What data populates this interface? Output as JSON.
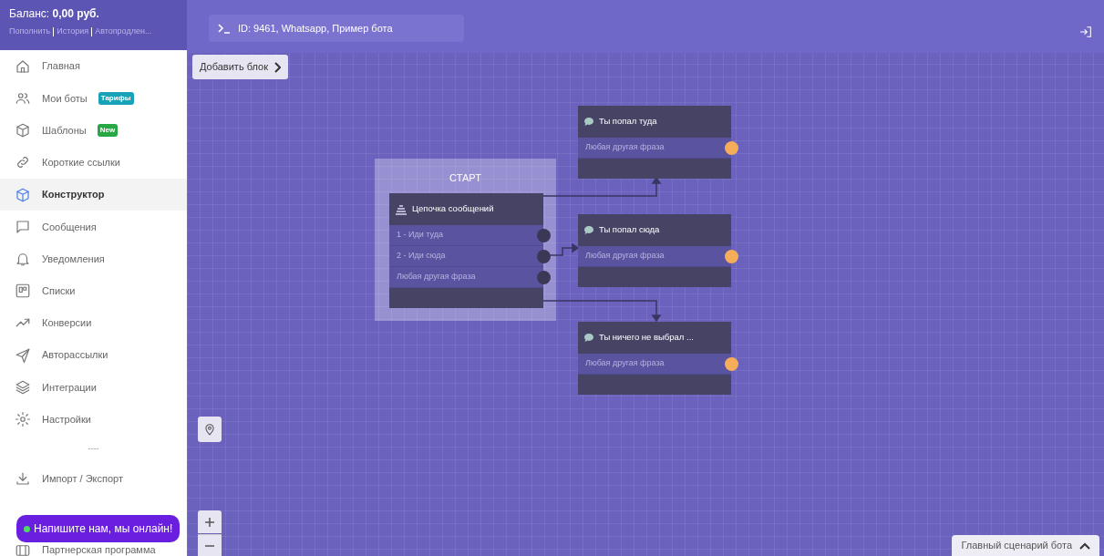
{
  "sidebar": {
    "balance": "Баланс: **0,00 руб.**",
    "account_links": [
      "Пополнить",
      "История",
      "Автопродлен..."
    ],
    "items": [
      {
        "label": "Главная",
        "selected": false
      },
      {
        "label": "Мои боты",
        "selected": false,
        "badge": {
          "text": "Тарифы",
          "color": "#17a2b8"
        }
      },
      {
        "label": "Шаблоны",
        "selected": false,
        "badge": {
          "text": "New",
          "color": "#28a745"
        }
      },
      {
        "label": "Короткие ссылки",
        "selected": false
      },
      {
        "label": "Конструктор",
        "selected": true
      },
      {
        "label": "Сообщения",
        "selected": false
      },
      {
        "label": "Уведомления",
        "selected": false
      },
      {
        "label": "Списки",
        "selected": false
      },
      {
        "label": "Конверсии",
        "selected": false
      },
      {
        "label": "Авторассылки",
        "selected": false
      },
      {
        "label": "Интеграции",
        "selected": false
      },
      {
        "label": "Настройки",
        "selected": false
      }
    ],
    "divider": "----",
    "bottom_items": [
      {
        "label": "Импорт / Экспорт"
      },
      {
        "label": "Партнерская программа"
      }
    ],
    "chat_widget": "Напишите нам, мы онлайн!"
  },
  "topbar": {
    "title": "ID: 9461, Whatsapp, Пример бота"
  },
  "canvas": {
    "add_block_button": "Добавить блок",
    "start_group": "СТАРТ",
    "nodes": [
      {
        "kind": "chain",
        "title": "Цепочка сообщений",
        "rows": [
          "1 - Иди туда",
          "2 - Иди сюда",
          "Любая другая фраза"
        ]
      },
      {
        "kind": "message",
        "title": "Ты попал туда",
        "rows": [
          "Любая другая фраза"
        ]
      },
      {
        "kind": "message",
        "title": "Ты попал сюда",
        "rows": [
          "Любая другая фраза"
        ]
      },
      {
        "kind": "message",
        "title": "Ты ничего не выбрал ...",
        "rows": [
          "Любая другая фраза"
        ]
      }
    ],
    "scenario_tab": "Главный сценарий бота"
  }
}
